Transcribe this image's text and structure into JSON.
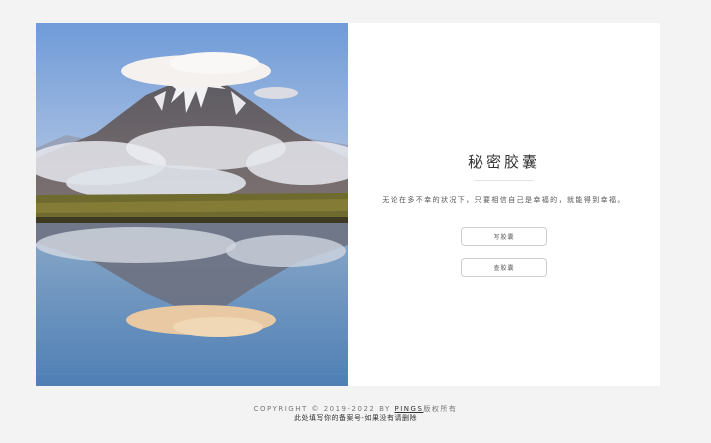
{
  "capsule": {
    "title": "秘密胶囊",
    "subtitle": "无论在多不幸的状况下，只要相信自己是幸福的，就能得到幸福。",
    "write_button": "写胶囊",
    "view_button": "查胶囊"
  },
  "footer": {
    "copyright": "COPYRIGHT © 2019-2022 BY ",
    "brand": "PINGS",
    "brand_suffix": "版权所有",
    "beian": "此处填写你的备案号-如果没有请删除"
  },
  "colors": {
    "page_bg": "#f3f3f3",
    "card_bg": "#ffffff",
    "text": "#333333"
  },
  "image": {
    "subject": "snow-capped volcano with cloud and lake reflection"
  }
}
